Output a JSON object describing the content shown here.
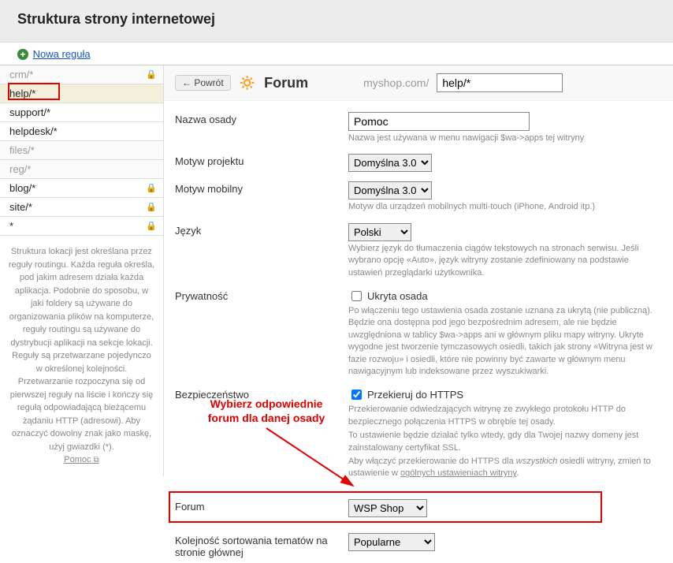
{
  "header": {
    "title": "Struktura strony internetowej"
  },
  "topbar": {
    "new_rule": "Nowa reguła"
  },
  "sidebar": {
    "rules": [
      {
        "label": "crm/*",
        "disabled": true,
        "locked": true,
        "active": false
      },
      {
        "label": "help/*",
        "disabled": false,
        "locked": false,
        "active": true
      },
      {
        "label": "support/*",
        "disabled": false,
        "locked": false,
        "active": false
      },
      {
        "label": "helpdesk/*",
        "disabled": false,
        "locked": false,
        "active": false
      },
      {
        "label": "files/*",
        "disabled": true,
        "locked": false,
        "active": false
      },
      {
        "label": "reg/*",
        "disabled": true,
        "locked": false,
        "active": false
      },
      {
        "label": "blog/*",
        "disabled": false,
        "locked": true,
        "active": false
      },
      {
        "label": "site/*",
        "disabled": false,
        "locked": true,
        "active": false
      },
      {
        "label": "*",
        "disabled": false,
        "locked": true,
        "active": false
      }
    ],
    "note": "Struktura lokacji jest określana przez reguły routingu. Każda reguła określa, pod jakim adresem działa każda aplikacja. Podobnie do sposobu, w jaki foldery są używane do organizowania plików na komputerze, reguły routingu są używane do dystrybucji aplikacji na sekcje lokacji. Reguły są przetwarzane pojedynczo w określonej kolejności. Przetwarzanie rozpoczyna się od pierwszej reguły na liście i kończy się regułą odpowiadającą bieżącemu żądaniu HTTP (adresowi). Aby oznaczyć dowolny znak jako maskę, użyj gwiazdki (*).",
    "help_link": "Pomoc"
  },
  "main": {
    "back": "← Powrót",
    "page_title": "Forum",
    "domain": "myshop.com/",
    "url_value": "help/*",
    "fields": {
      "name": {
        "label": "Nazwa osady",
        "value": "Pomoc",
        "hint": "Nazwa jest używana w menu nawigacji $wa->apps tej witryny"
      },
      "theme": {
        "label": "Motyw projektu",
        "value": "Domyślna 3.0"
      },
      "mobile_theme": {
        "label": "Motyw mobilny",
        "value": "Domyślna 3.0",
        "hint": "Motyw dla urządzeń mobilnych multi-touch (iPhone, Android itp.)"
      },
      "language": {
        "label": "Język",
        "value": "Polski",
        "hint": "Wybierz język do tłumaczenia ciągów tekstowych na stronach serwisu. Jeśli wybrano opcję «Auto», język witryny zostanie zdefiniowany na podstawie ustawień przeglądarki użytkownika."
      },
      "privacy": {
        "label": "Prywatność",
        "check_label": "Ukryta osada",
        "checked": false,
        "hint": "Po włączeniu tego ustawienia osada zostanie uznana za ukrytą (nie publiczną). Będzie ona dostępna pod jego bezpośrednim adresem, ale nie będzie uwzględniona w tablicy $wa->apps ani w głównym pliku mapy witryny. Ukryte wygodne jest tworzenie tymczasowych osiedli, takich jak strony «Witryna jest w fazie rozwoju» i osiedli, które nie powinny być zawarte w głównym menu nawigacyjnym lub indeksowane przez wyszukiwarki."
      },
      "security": {
        "label": "Bezpieczeństwo",
        "check_label": "Przekieruj do HTTPS",
        "checked": true,
        "hint1": "Przekierowanie odwiedzających witrynę ze zwykłego protokołu HTTP do bezpiecznego połączenia HTTPS w obrębie tej osady.",
        "hint2": "To ustawienie będzie działać tylko wtedy, gdy dla Twojej nazwy domeny jest zainstalowany certyfikat SSL.",
        "hint3_a": "Aby włączyć przekierowanie do HTTPS dla ",
        "hint3_em": "wszystkich",
        "hint3_b": " osiedli witryny, zmień to ustawienie w ",
        "hint3_link": "ogólnych ustawieniach witryny",
        "hint3_c": "."
      },
      "forum": {
        "label": "Forum",
        "value": "WSP Shop"
      },
      "sort": {
        "label": "Kolejność sortowania tematów na stronie głównej",
        "value": "Popularne"
      }
    }
  },
  "annotation": {
    "text_line1": "Wybierz odpowiednie",
    "text_line2": "forum dla danej osady"
  }
}
